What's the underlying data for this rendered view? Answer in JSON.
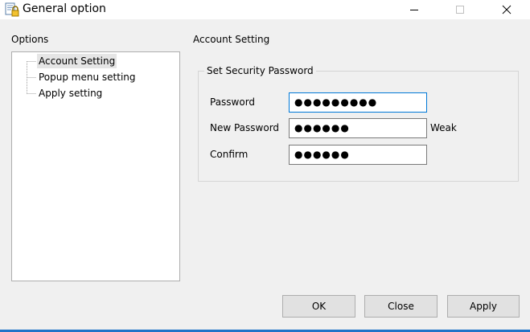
{
  "window": {
    "title": "General option"
  },
  "sidebar": {
    "label": "Options",
    "items": [
      {
        "label": "Account Setting",
        "selected": true
      },
      {
        "label": "Popup menu setting",
        "selected": false
      },
      {
        "label": "Apply setting",
        "selected": false
      }
    ]
  },
  "main": {
    "title": "Account Setting",
    "group": {
      "title": "Set Security Password",
      "fields": [
        {
          "label": "Password",
          "value": "●●●●●●●●●",
          "focused": true
        },
        {
          "label": "New Password",
          "value": "●●●●●●",
          "focused": false
        },
        {
          "label": "Confirm",
          "value": "●●●●●●",
          "focused": false
        }
      ],
      "strength": "Weak"
    }
  },
  "buttons": {
    "ok": "OK",
    "close": "Close",
    "apply": "Apply"
  },
  "colors": {
    "accent": "#0078d7",
    "taskbar": "#1f73c8",
    "background": "#f0f0f0"
  },
  "icons": {
    "app": "password-lock-icon",
    "minimize": "minimize-icon",
    "maximize": "maximize-icon",
    "close": "close-icon"
  }
}
